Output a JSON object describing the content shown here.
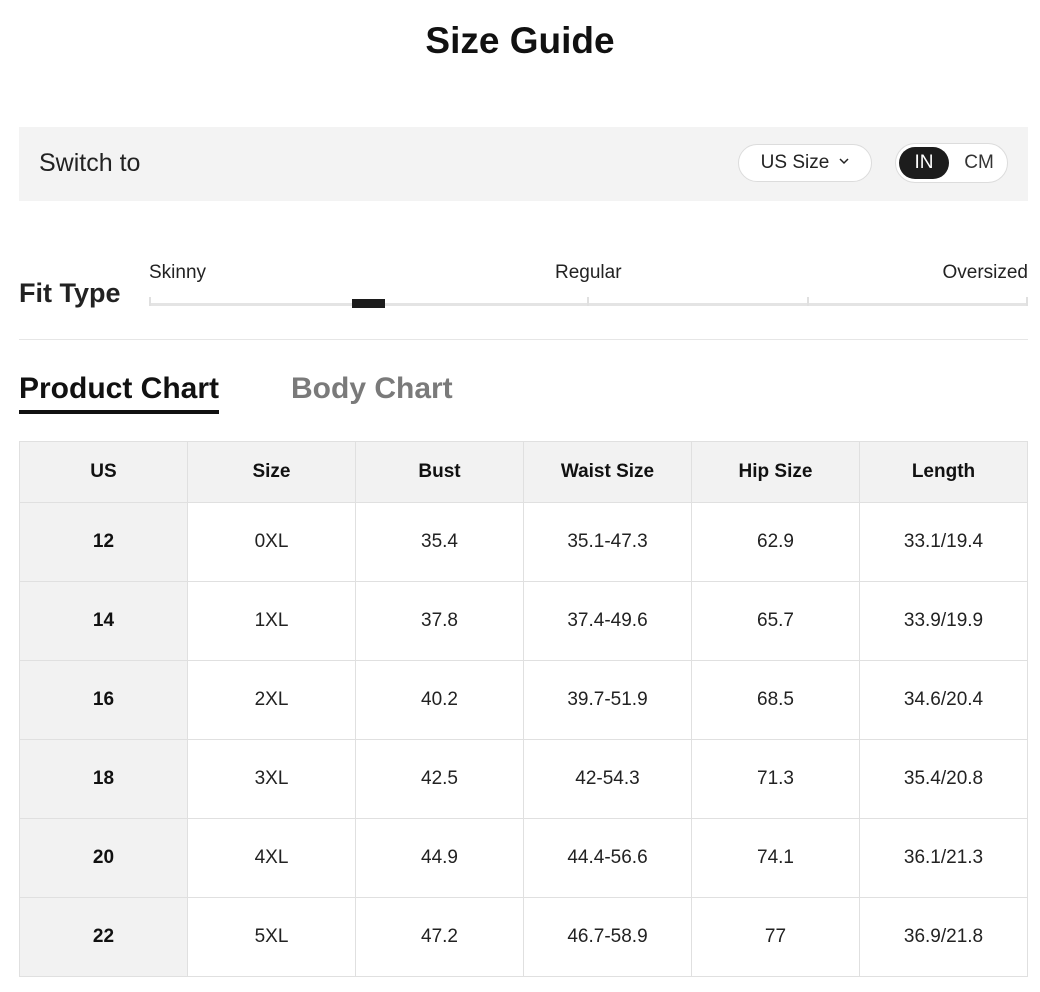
{
  "page": {
    "title": "Size Guide"
  },
  "switch_bar": {
    "label": "Switch to",
    "size_system": {
      "selected": "US Size",
      "icon": "chevron-down-icon"
    },
    "units": [
      {
        "label": "IN",
        "active": true
      },
      {
        "label": "CM",
        "active": false
      }
    ]
  },
  "fit_type": {
    "label": "Fit Type",
    "scale_labels": [
      "Skinny",
      "Regular",
      "Oversized"
    ],
    "indicator_level": 0.25
  },
  "tabs": [
    {
      "label": "Product Chart",
      "active": true
    },
    {
      "label": "Body Chart",
      "active": false
    }
  ],
  "size_table": {
    "headers": [
      "US",
      "Size",
      "Bust",
      "Waist Size",
      "Hip Size",
      "Length"
    ],
    "rows": [
      [
        "12",
        "0XL",
        "35.4",
        "35.1-47.3",
        "62.9",
        "33.1/19.4"
      ],
      [
        "14",
        "1XL",
        "37.8",
        "37.4-49.6",
        "65.7",
        "33.9/19.9"
      ],
      [
        "16",
        "2XL",
        "40.2",
        "39.7-51.9",
        "68.5",
        "34.6/20.4"
      ],
      [
        "18",
        "3XL",
        "42.5",
        "42-54.3",
        "71.3",
        "35.4/20.8"
      ],
      [
        "20",
        "4XL",
        "44.9",
        "44.4-56.6",
        "74.1",
        "36.1/21.3"
      ],
      [
        "22",
        "5XL",
        "47.2",
        "46.7-58.9",
        "77",
        "36.9/21.8"
      ]
    ]
  },
  "colors": {
    "accent": "#1c1c1c",
    "panel_bg": "#f3f3f3",
    "inactive_tab": "#7a7a7a"
  }
}
